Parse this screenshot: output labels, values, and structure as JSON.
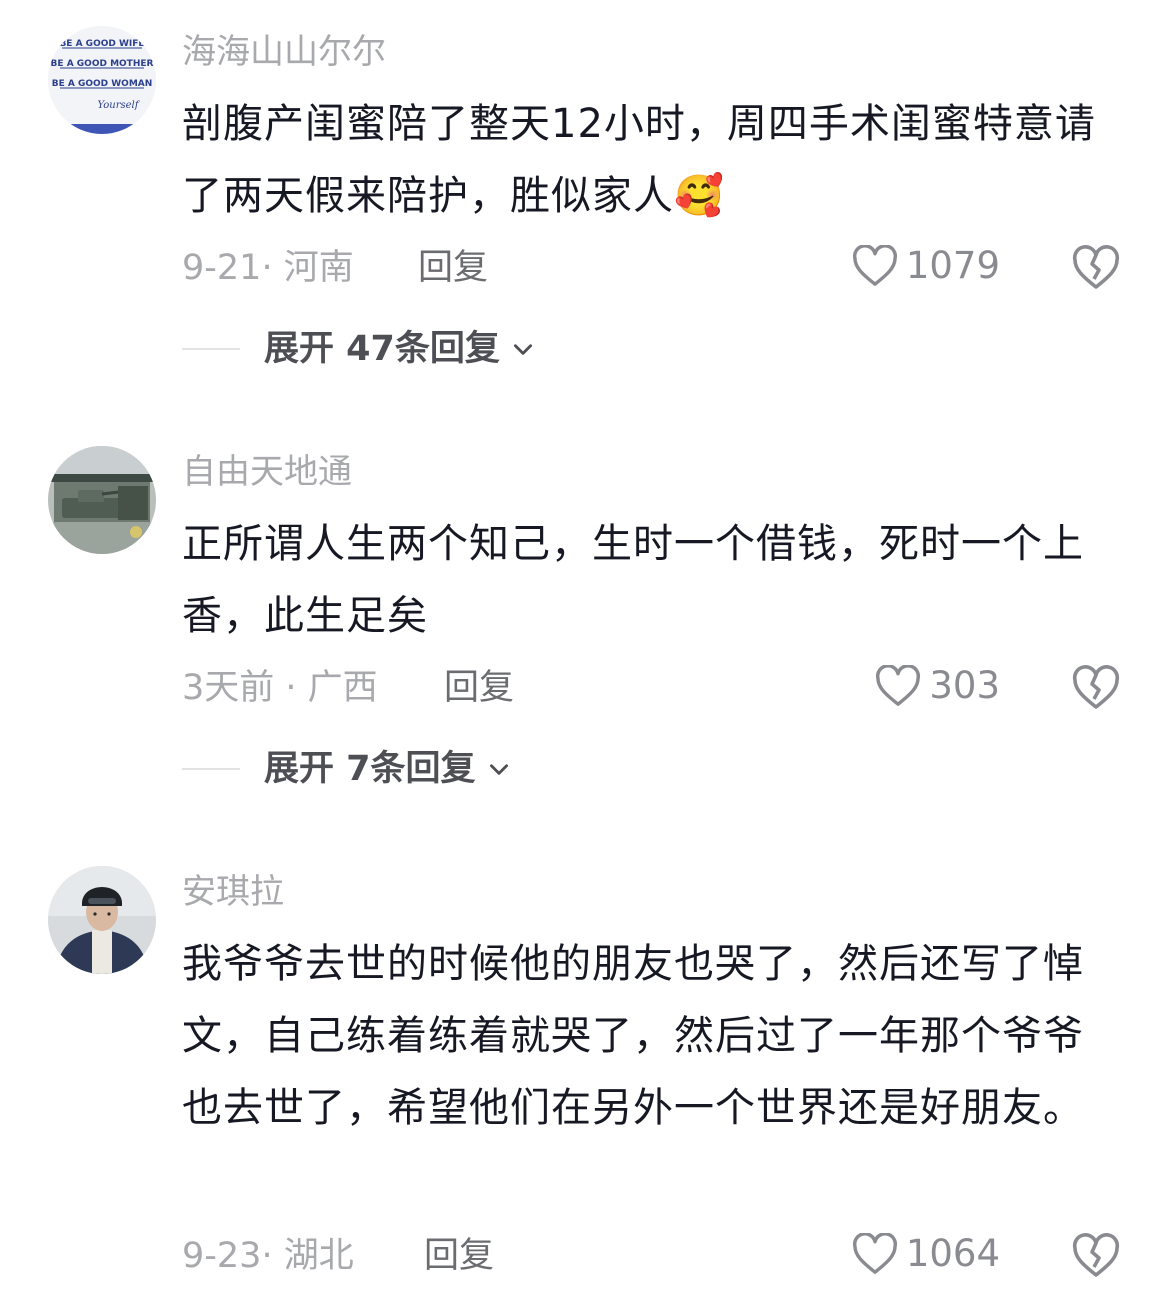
{
  "comments": [
    {
      "username": "海海山山尔尔",
      "text": "剖腹产闺蜜陪了整天12小时，周四手术闺蜜特意请了两天假来陪护，胜似家人🥰",
      "date": "9-21",
      "location": "河南",
      "reply_label": "回复",
      "likes": "1079",
      "expand_label": "展开 47条回复",
      "avatar_lines": [
        "BE A GOOD WIFE",
        "BE A GOOD MOTHER",
        "BE A GOOD WOMAN",
        "Yourself"
      ]
    },
    {
      "username": "自由天地通",
      "text": "正所谓人生两个知己，生时一个借钱，死时一个上香，此生足矣",
      "date": "3天前",
      "location": "广西",
      "reply_label": "回复",
      "likes": "303",
      "expand_label": "展开 7条回复"
    },
    {
      "username": "安琪拉",
      "text": "我爷爷去世的时候他的朋友也哭了，然后还写了悼文，自己练着练着就哭了，然后过了一年那个爷爷也去世了，希望他们在另外一个世界还是好朋友。",
      "date": "9-23",
      "location": "湖北",
      "reply_label": "回复",
      "likes": "1064"
    }
  ],
  "colors": {
    "text_primary": "#161823",
    "text_secondary": "#a8a9ad",
    "icon_gray": "#8a8b90"
  }
}
